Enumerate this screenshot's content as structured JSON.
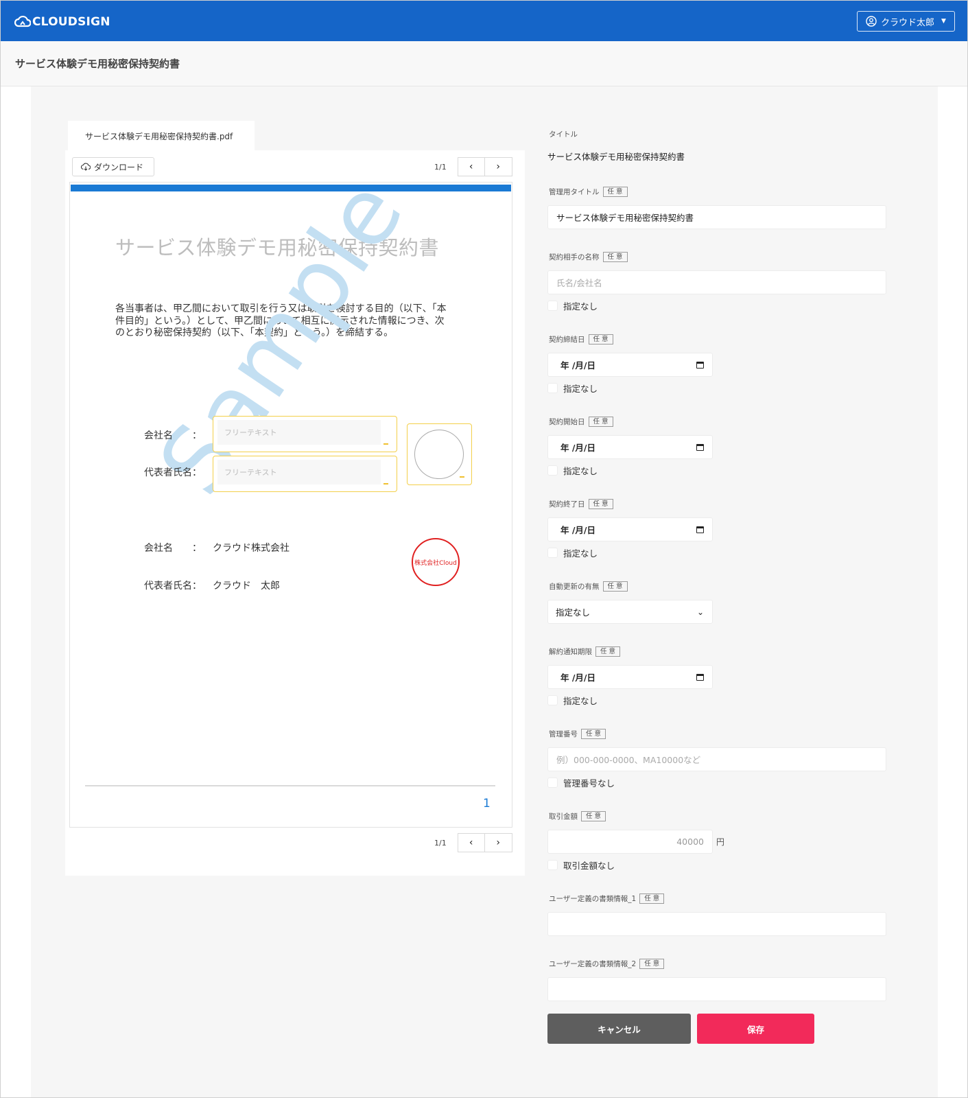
{
  "app": {
    "logo_text": "CLOUDSIGN",
    "user_name": "クラウド太郎"
  },
  "page": {
    "title": "サービス体験デモ用秘密保持契約書"
  },
  "viewer": {
    "file_tab": "サービス体験デモ用秘密保持契約書.pdf",
    "download_label": "ダウンロード",
    "page_count": "1/1",
    "document": {
      "title": "サービス体験デモ用秘密保持契約書",
      "body_lines": [
        "各当事者は、甲乙間において取引を行う又は取引を検討する目的（以下、「本",
        "件目的」という。）として、甲乙間において相互に開示された情報につき、次",
        "のとおり秘密保持契約（以下、「本契約」という。）を締結する。"
      ],
      "watermark": "Sample",
      "party_a": {
        "company_label": "会社名　　：",
        "rep_label": "代表者氏名：",
        "company_placeholder": "フリーテキスト",
        "rep_placeholder": "フリーテキスト"
      },
      "party_b": {
        "company_label": "会社名　　：",
        "company_value": "クラウド株式会社",
        "rep_label": "代表者氏名：",
        "rep_value": "クラウド　太郎",
        "seal_text": "株式会社Cloud"
      },
      "page_number": "1"
    }
  },
  "form": {
    "optional_tag": "任 意",
    "title": {
      "label": "タイトル",
      "value": "サービス体験デモ用秘密保持契約書"
    },
    "management_title": {
      "label": "管理用タイトル",
      "value": "サービス体験デモ用秘密保持契約書"
    },
    "counterparty": {
      "label": "契約相手の名称",
      "placeholder": "氏名/会社名",
      "none_label": "指定なし"
    },
    "conclusion_date": {
      "label": "契約締結日",
      "value": "年 /月/日",
      "none_label": "指定なし"
    },
    "start_date": {
      "label": "契約開始日",
      "value": "年 /月/日",
      "none_label": "指定なし"
    },
    "end_date": {
      "label": "契約終了日",
      "value": "年 /月/日",
      "none_label": "指定なし"
    },
    "auto_renewal": {
      "label": "自動更新の有無",
      "value": "指定なし"
    },
    "cancel_notice": {
      "label": "解約通知期限",
      "value": "年 /月/日",
      "none_label": "指定なし"
    },
    "management_no": {
      "label": "管理番号",
      "placeholder": "例）000-000-0000、MA10000など",
      "none_label": "管理番号なし"
    },
    "amount": {
      "label": "取引金額",
      "value": "40000",
      "unit": "円",
      "none_label": "取引金額なし"
    },
    "user_defined_1": {
      "label": "ユーザー定義の書類情報_1",
      "value": ""
    },
    "user_defined_2": {
      "label": "ユーザー定義の書類情報_2",
      "value": ""
    },
    "cancel_button": "キャンセル",
    "save_button": "保存"
  },
  "colors": {
    "header": "#1565c8",
    "accent_blue": "#1a7ad4",
    "save": "#f22a5a",
    "cancel": "#5e5e5e",
    "seal": "#e02020",
    "field_border": "#f3cf49"
  }
}
